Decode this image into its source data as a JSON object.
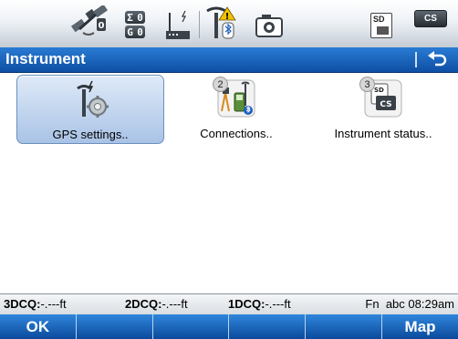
{
  "status_bar": {
    "icons": [
      "satellite-icon",
      "sat-count-icon",
      "radio-icon",
      "bluetooth-warning-icon",
      "camera-icon",
      "sd-card-icon",
      "cs-controller-icon"
    ],
    "sat_count": {
      "sigma": "Σ",
      "sigma_value": "0",
      "gps": "G",
      "gps_value": "0"
    },
    "sd_label": "SD",
    "cs_label": "CS"
  },
  "title_bar": {
    "title": "Instrument",
    "back_icon": "back-arrow-icon"
  },
  "tiles": [
    {
      "label": "GPS settings..",
      "icon": "gps-settings-icon",
      "badge": "",
      "selected": true
    },
    {
      "label": "Connections..",
      "icon": "connections-icon",
      "badge": "2",
      "selected": false
    },
    {
      "label": "Instrument status..",
      "icon": "instrument-status-icon",
      "badge": "3",
      "selected": false
    }
  ],
  "info_bar": {
    "dcq3_label": "3DCQ:",
    "dcq3_value": "-.---ft",
    "dcq2_label": "2DCQ:",
    "dcq2_value": "-.---ft",
    "dcq1_label": "1DCQ:",
    "dcq1_value": "-.---ft",
    "fn": "Fn",
    "input_mode": "abc",
    "time": "08:29am"
  },
  "softkeys": [
    "OK",
    "",
    "",
    "",
    "",
    "Map"
  ],
  "colors": {
    "title_bar": "#1a66c0",
    "softkey_bar": "#1a66c0",
    "tile_selected": "#bcd3ef",
    "info_bar": "#e4e7ea"
  }
}
